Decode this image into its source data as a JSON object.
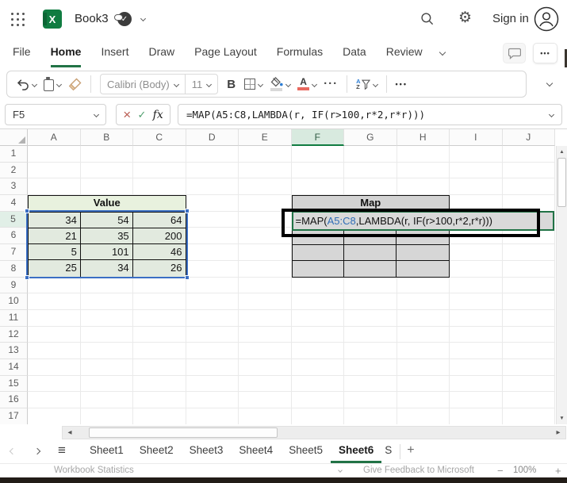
{
  "window": {
    "title": "Book3",
    "signin_label": "Sign in"
  },
  "menu": {
    "items": [
      {
        "label": "File",
        "active": false
      },
      {
        "label": "Home",
        "active": true
      },
      {
        "label": "Insert",
        "active": false
      },
      {
        "label": "Draw",
        "active": false
      },
      {
        "label": "Page Layout",
        "active": false
      },
      {
        "label": "Formulas",
        "active": false
      },
      {
        "label": "Data",
        "active": false
      },
      {
        "label": "Review",
        "active": false
      }
    ]
  },
  "toolbar": {
    "font_name": "Calibri (Body)",
    "font_size": "11",
    "bold_label": "B"
  },
  "formula_bar": {
    "name_box": "F5",
    "cancel_glyph": "×",
    "enter_glyph": "✓",
    "fx_label": "fx",
    "formula": "=MAP(A5:C8,LAMBDA(r, IF(r>100,r*2,r*r)))"
  },
  "grid": {
    "columns": [
      "A",
      "B",
      "C",
      "D",
      "E",
      "F",
      "G",
      "H",
      "I",
      "J"
    ],
    "active_column": "F",
    "row_count": 17,
    "active_row": 5
  },
  "value_table": {
    "header": "Value",
    "rows": [
      [
        "34",
        "54",
        "64"
      ],
      [
        "21",
        "35",
        "200"
      ],
      [
        "5",
        "101",
        "46"
      ],
      [
        "25",
        "34",
        "26"
      ]
    ]
  },
  "map_table": {
    "header": "Map",
    "formula_parts": {
      "prefix": "=MAP(",
      "range": "A5:C8",
      "suffix": ",LAMBDA(r, IF(r>100,r*2,r*r)))"
    }
  },
  "sheet_bar": {
    "tabs": [
      "Sheet1",
      "Sheet2",
      "Sheet3",
      "Sheet4",
      "Sheet5",
      "Sheet6"
    ],
    "active_tab": "Sheet6",
    "partial_tab": "S",
    "add_label": "+"
  },
  "status_bar": {
    "left": "Workbook Statistics",
    "feedback": "Give Feedback to Microsoft",
    "zoom": "100%",
    "minus": "−",
    "plus": "+"
  },
  "colors": {
    "excel_green": "#107C41",
    "accent_green_border": "#217346",
    "value_header_fill": "#E8F1DE",
    "value_cell_fill": "#E2EADF",
    "map_fill": "#D6D6D6",
    "selection_blue": "#3B6FC4",
    "formula_range_blue": "#2F6DB6",
    "font_color_red": "#E8695F"
  }
}
